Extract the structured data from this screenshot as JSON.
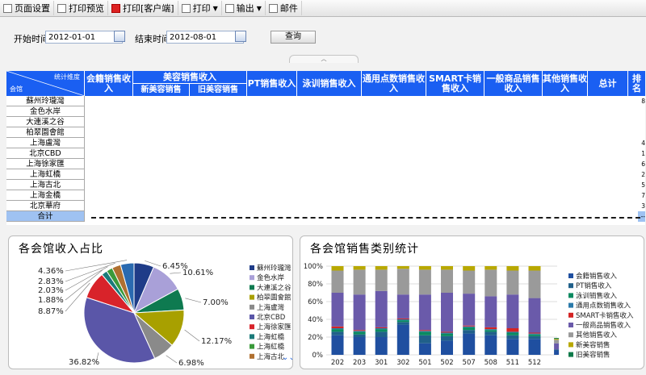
{
  "toolbar": {
    "page_setup": "页面设置",
    "print_preview": "打印预览",
    "print_client": "打印[客户端]",
    "print": "打印",
    "export": "输出",
    "email": "邮件"
  },
  "filter": {
    "start_label": "开始时间:",
    "start_value": "2012-01-01",
    "end_label": "结束时间:",
    "end_value": "2012-08-01",
    "query_button": "查询"
  },
  "table": {
    "corner_top": "统计维度",
    "corner_bottom": "会馆",
    "headers": {
      "membership": "会籍销售收入",
      "beauty": "美容销售收入",
      "beauty_new": "新美容销售",
      "beauty_old": "旧美容销售",
      "pt": "PT销售收入",
      "swim": "泳训销售收入",
      "points": "通用点数销售收入",
      "smart": "SMART卡销售收入",
      "goods": "一般商品销售收入",
      "other": "其他销售收入",
      "total": "总计",
      "rank": "排名"
    },
    "rows": [
      {
        "name": "蘇州玲瓏灣",
        "rank": "8"
      },
      {
        "name": "金色水岸",
        "rank": ""
      },
      {
        "name": "大連溪之谷",
        "rank": ""
      },
      {
        "name": "柏翠園會館",
        "rank": ""
      },
      {
        "name": "上海盧灣",
        "rank": "4"
      },
      {
        "name": "北京CBD",
        "rank": "1"
      },
      {
        "name": "上海徐家匯",
        "rank": "6"
      },
      {
        "name": "上海虹橋",
        "rank": "2"
      },
      {
        "name": "上海古北",
        "rank": "5"
      },
      {
        "name": "上海金橋",
        "rank": "7"
      },
      {
        "name": "北京華府",
        "rank": "3"
      }
    ],
    "total_label": "合计",
    "total_rank": "--"
  },
  "pie_panel": {
    "title": "各会馆收入占比",
    "chart_data": {
      "type": "pie",
      "title": "各会馆收入占比",
      "slices": [
        {
          "name": "蘇州玲瓏灣",
          "value": 6.45,
          "color": "#1f3c88"
        },
        {
          "name": "金色水岸",
          "value": 10.61,
          "color": "#a9a0d8"
        },
        {
          "name": "大連溪之谷",
          "value": 7.0,
          "color": "#0e7a50"
        },
        {
          "name": "柏翠園會館",
          "value": 12.17,
          "color": "#a8a000"
        },
        {
          "name": "上海盧灣",
          "value": 6.98,
          "color": "#8a8a8a"
        },
        {
          "name": "北京CBD",
          "value": 36.82,
          "color": "#5a56a8"
        },
        {
          "name": "上海徐家匯",
          "value": 8.87,
          "color": "#d8232a"
        },
        {
          "name": "上海虹橋",
          "value": 1.88,
          "color": "#1a7a7a"
        },
        {
          "name": "上海紅橋",
          "value": 2.03,
          "color": "#3a9a3a"
        },
        {
          "name": "上海古北",
          "value": 2.83,
          "color": "#b07030"
        },
        {
          "name": "",
          "value": 4.36,
          "color": "#2a6ab0"
        }
      ],
      "value_labels": [
        "6.45%",
        "10.61%",
        "7.00%",
        "12.17%",
        "6.98%",
        "36.82%",
        "8.87%",
        "1.88%",
        "2.03%",
        "2.83%",
        "4.36%"
      ]
    }
  },
  "bar_panel": {
    "title": "各会馆销售类别统计",
    "chart_data": {
      "type": "bar",
      "stacked": "percent",
      "title": "各会馆销售类别统计",
      "categories": [
        "202",
        "203",
        "301",
        "302",
        "501",
        "502",
        "507",
        "508",
        "511",
        "512",
        ""
      ],
      "ylim": [
        0,
        100
      ],
      "yticks": [
        "0%",
        "20%",
        "40%",
        "60%",
        "80%",
        "100%"
      ],
      "legend_position": "right",
      "series": [
        {
          "name": "会籍销售收入",
          "color": "#1f4fa0",
          "values": [
            22,
            20,
            20,
            34,
            13,
            16,
            24,
            22,
            18,
            18,
            5
          ]
        },
        {
          "name": "PT销售收入",
          "color": "#20608a",
          "values": [
            4,
            3,
            6,
            3,
            9,
            5,
            4,
            4,
            4,
            3,
            1
          ]
        },
        {
          "name": "泳训销售收入",
          "color": "#0a8a60",
          "values": [
            3,
            3,
            3,
            2,
            4,
            3,
            3,
            2,
            3,
            2,
            0
          ]
        },
        {
          "name": "通用点数销售收入",
          "color": "#2a7aaa",
          "values": [
            1,
            1,
            1,
            1,
            1,
            1,
            1,
            1,
            1,
            1,
            0
          ]
        },
        {
          "name": "SMART卡销售收入",
          "color": "#d42424",
          "values": [
            2,
            1,
            1,
            1,
            1,
            1,
            1,
            2,
            4,
            1,
            0
          ]
        },
        {
          "name": "一般商品销售收入",
          "color": "#6a5aaa",
          "values": [
            38,
            40,
            41,
            27,
            40,
            44,
            36,
            35,
            38,
            39,
            7
          ]
        },
        {
          "name": "其他销售收入",
          "color": "#9a9a9a",
          "values": [
            25,
            28,
            24,
            29,
            28,
            26,
            26,
            30,
            27,
            31,
            4
          ]
        },
        {
          "name": "新美容销售",
          "color": "#b8a800",
          "values": [
            5,
            4,
            4,
            3,
            4,
            4,
            5,
            4,
            5,
            5,
            1
          ]
        },
        {
          "name": "旧美容销售",
          "color": "#0e7a4a",
          "values": [
            0,
            0,
            0,
            0,
            0,
            0,
            0,
            0,
            0,
            0,
            1
          ]
        }
      ]
    }
  }
}
